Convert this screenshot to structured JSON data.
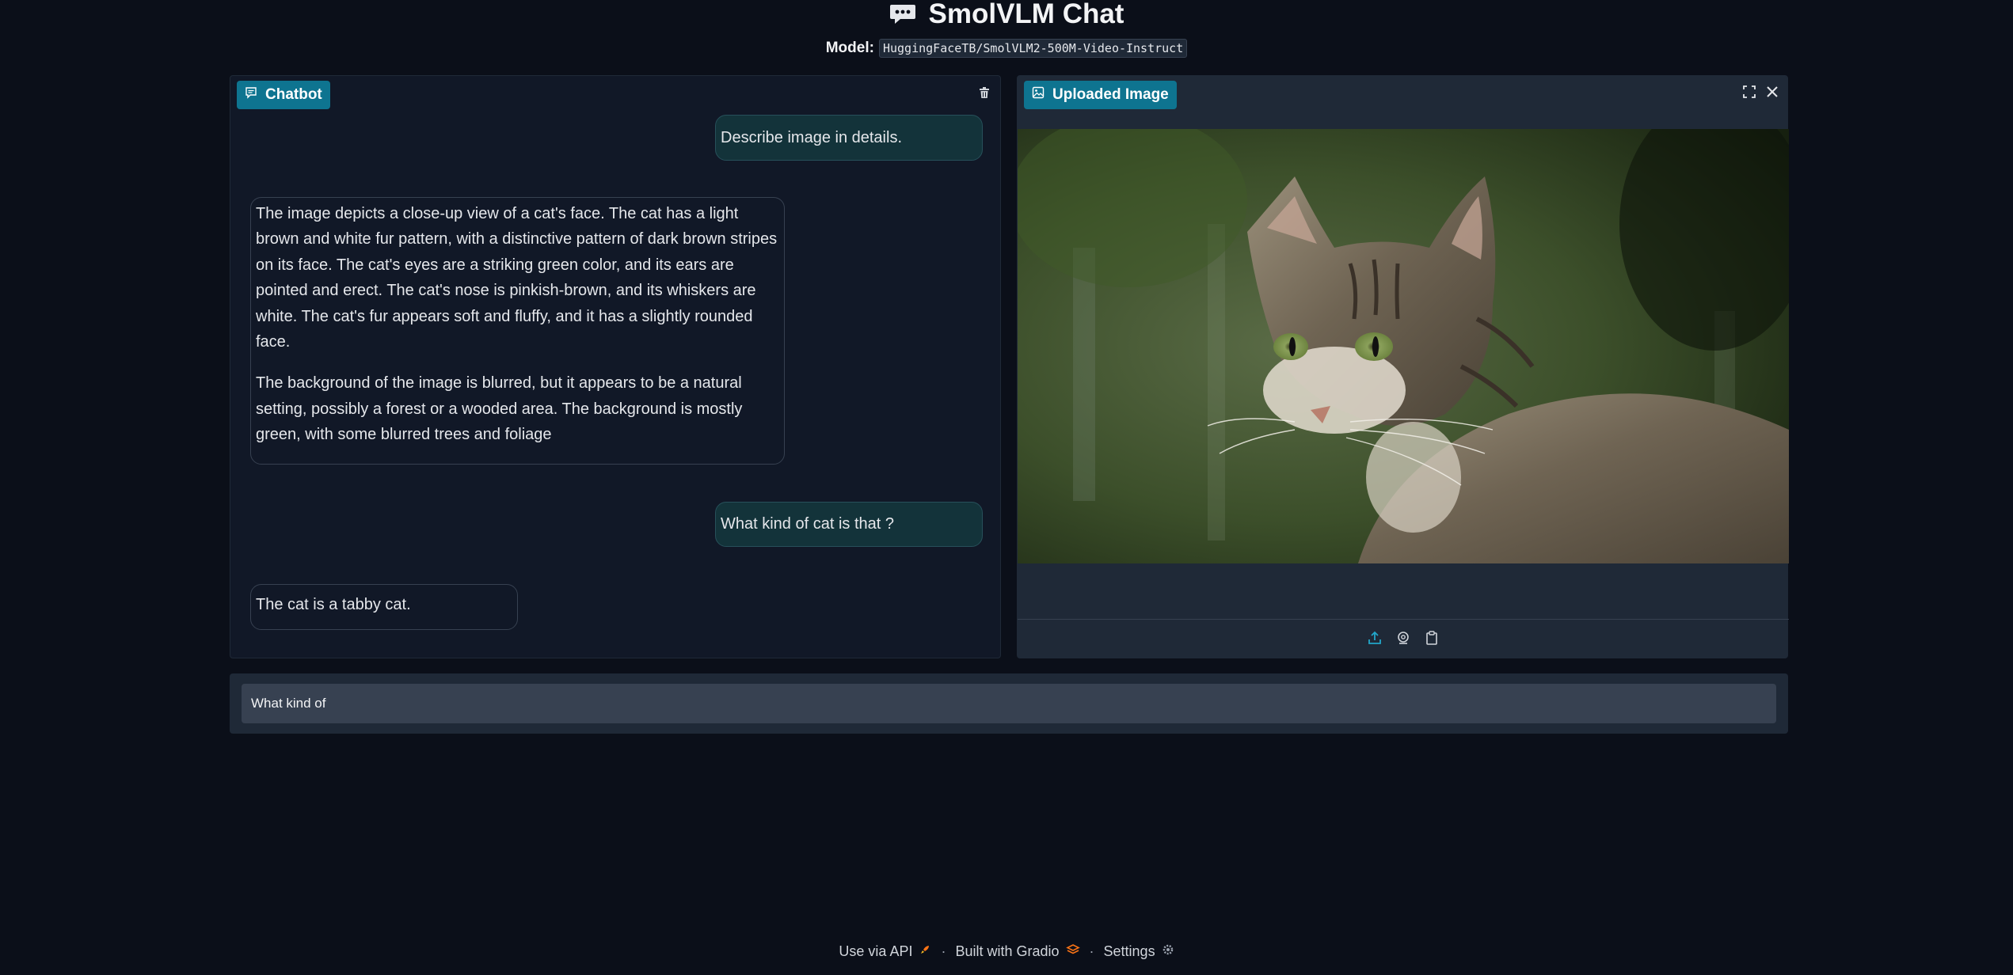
{
  "header": {
    "title": "SmolVLM Chat",
    "model_label": "Model:",
    "model_name": "HuggingFaceTB/SmolVLM2-500M-Video-Instruct"
  },
  "chatbot": {
    "label": "Chatbot",
    "messages": [
      {
        "role": "user",
        "text": "Describe image in details."
      },
      {
        "role": "assistant",
        "paragraphs": [
          "The image depicts a close-up view of a cat's face. The cat has a light brown and white fur pattern, with a distinctive pattern of dark brown stripes on its face. The cat's eyes are a striking green color, and its ears are pointed and erect. The cat's nose is pinkish-brown, and its whiskers are white. The cat's fur appears soft and fluffy, and it has a slightly rounded face.",
          "The background of the image is blurred, but it appears to be a natural setting, possibly a forest or a wooded area. The background is mostly green, with some blurred trees and foliage"
        ]
      },
      {
        "role": "user",
        "text": "What kind of cat is that ?"
      },
      {
        "role": "assistant",
        "paragraphs": [
          "The cat is a tabby cat."
        ]
      }
    ]
  },
  "image_panel": {
    "label": "Uploaded Image"
  },
  "input": {
    "value": "What kind of "
  },
  "footer": {
    "api_label": "Use via API",
    "built_label": "Built with Gradio",
    "settings_label": "Settings",
    "separator": "·"
  },
  "colors": {
    "background": "#0b0f19",
    "panel": "#111827",
    "accent": "#0e7490",
    "user_bubble": "#13333a"
  }
}
